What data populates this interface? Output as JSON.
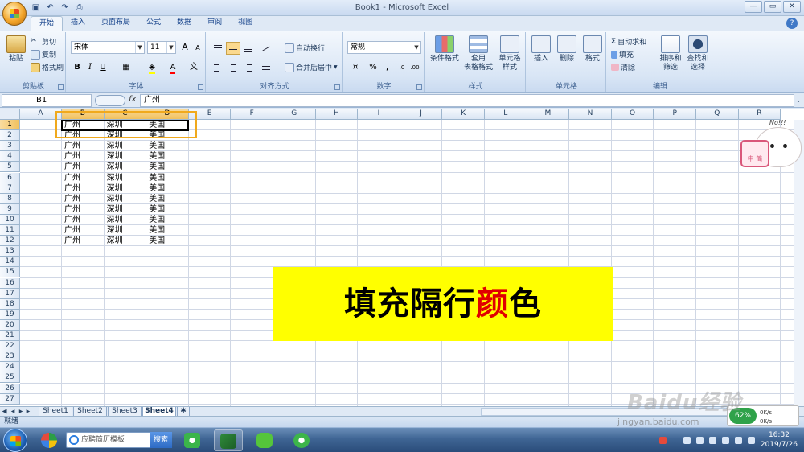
{
  "window": {
    "title": "Book1 - Microsoft Excel",
    "controls": [
      "—",
      "▭",
      "✕"
    ]
  },
  "ribbon": {
    "tabs": [
      "开始",
      "插入",
      "页面布局",
      "公式",
      "数据",
      "审阅",
      "视图"
    ],
    "active_tab": "开始",
    "clipboard": {
      "paste": "粘贴",
      "cut": "剪切",
      "copy": "复制",
      "format_painter": "格式刷",
      "label": "剪贴板"
    },
    "font": {
      "name": "宋体",
      "size": "11",
      "bold": "B",
      "italic": "I",
      "underline": "U",
      "label": "字体",
      "grow": "A",
      "shrink": "A"
    },
    "alignment": {
      "wrap": "自动换行",
      "merge": "合并后居中",
      "label": "对齐方式"
    },
    "number": {
      "format": "常规",
      "percent": "%",
      "comma": ",",
      "label": "数字"
    },
    "styles": {
      "conditional": "条件格式",
      "table_format_1": "套用",
      "table_format_2": "表格格式",
      "cell_style_1": "单元格",
      "cell_style_2": "样式",
      "label": "样式"
    },
    "cells": {
      "insert": "插入",
      "delete": "删除",
      "format": "格式",
      "label": "单元格"
    },
    "editing": {
      "autosum": "自动求和",
      "fill": "填充",
      "clear": "清除",
      "sort_1": "排序和",
      "sort_2": "筛选",
      "find_1": "查找和",
      "find_2": "选择",
      "label": "编辑"
    }
  },
  "formula_bar": {
    "name_box": "B1",
    "fx": "fx",
    "content": "广州"
  },
  "sheet": {
    "columns": [
      "A",
      "B",
      "C",
      "D",
      "E",
      "F",
      "G",
      "H",
      "I",
      "J",
      "K",
      "L",
      "M",
      "N",
      "O",
      "P",
      "Q",
      "R"
    ],
    "selected_columns": [
      "B",
      "C",
      "D"
    ],
    "row_count": 27,
    "selected_row": 1,
    "rows": [
      [
        "广州",
        "深圳",
        "美国"
      ],
      [
        "广州",
        "深圳",
        "美国"
      ],
      [
        "广州",
        "深圳",
        "美国"
      ],
      [
        "广州",
        "深圳",
        "美国"
      ],
      [
        "广州",
        "深圳",
        "美国"
      ],
      [
        "广州",
        "深圳",
        "美国"
      ],
      [
        "广州",
        "深圳",
        "美国"
      ],
      [
        "广州",
        "深圳",
        "美国"
      ],
      [
        "广州",
        "深圳",
        "美国"
      ],
      [
        "广州",
        "深圳",
        "美国"
      ],
      [
        "广州",
        "深圳",
        "美国"
      ],
      [
        "广州",
        "深圳",
        "美国"
      ]
    ],
    "overlay_caption": {
      "before": "填充隔行",
      "highlight": "颜",
      "after": "色"
    }
  },
  "sheet_tabs": [
    "Sheet1",
    "Sheet2",
    "Sheet3",
    "Sheet4"
  ],
  "active_sheet": "Sheet4",
  "status": "就绪",
  "mascot": {
    "bubble": "No!!!",
    "tag": "中 简"
  },
  "net_meter": {
    "percent": "62%",
    "up": "0K/s",
    "down": "0K/s"
  },
  "watermark": {
    "brand": "Baidu经验",
    "url": "jingyan.baidu.com"
  },
  "taskbar": {
    "search_placeholder": "应聘简历模板",
    "search_button": "搜索",
    "time": "16:32",
    "date": "2019/7/26"
  },
  "colors": {
    "accent_selection": "#f0a91d",
    "caption_bg": "#ffff00",
    "caption_red": "#e00000"
  }
}
